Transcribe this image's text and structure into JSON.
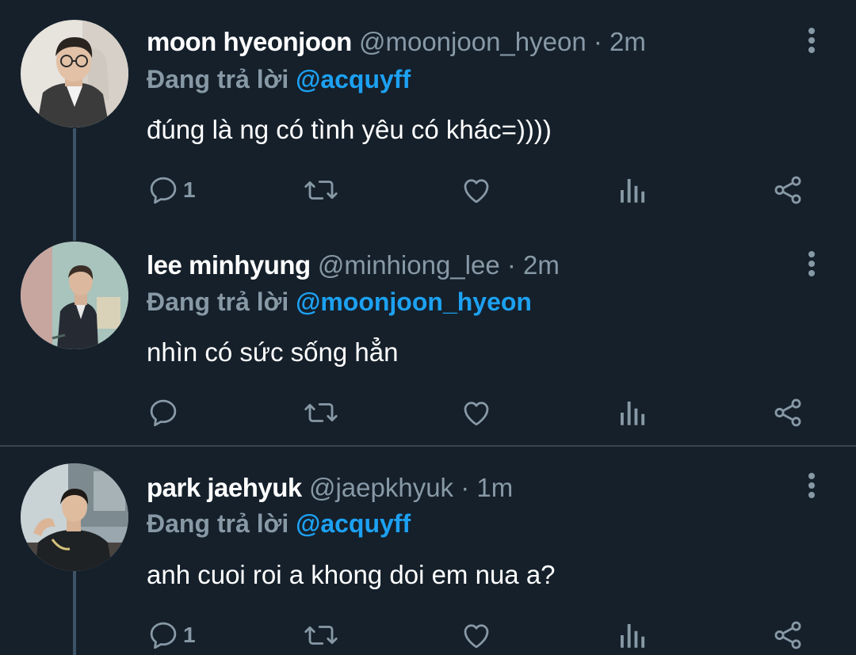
{
  "colors": {
    "background": "#15202b",
    "divider": "#38444d",
    "secondary_text": "#8899a6",
    "mention": "#1da1f2",
    "thread_line": "#3d5466"
  },
  "reply_prefix": "Đang trả lời",
  "tweets": [
    {
      "name": "moon hyeonjoon",
      "handle": "@moonjoon_hyeon",
      "separator": "·",
      "time": "2m",
      "replying_to": "@acquyff",
      "text": "đúng là ng có tình yêu có khác=))))",
      "reply_count": "1"
    },
    {
      "name": "lee minhyung",
      "handle": "@minhiong_lee",
      "separator": "·",
      "time": "2m",
      "replying_to": "@moonjoon_hyeon",
      "text": "nhìn có sức sống hẳn",
      "reply_count": ""
    },
    {
      "name": "park jaehyuk",
      "handle": "@jaepkhyuk",
      "separator": "·",
      "time": "1m",
      "replying_to": "@acquyff",
      "text": "anh cuoi roi a khong doi em nua a?",
      "reply_count": "1"
    }
  ],
  "icons": {
    "reply": "reply-icon",
    "retweet": "retweet-icon",
    "like": "heart-icon",
    "analytics": "analytics-icon",
    "share": "share-icon",
    "more": "more-vertical-icon"
  }
}
